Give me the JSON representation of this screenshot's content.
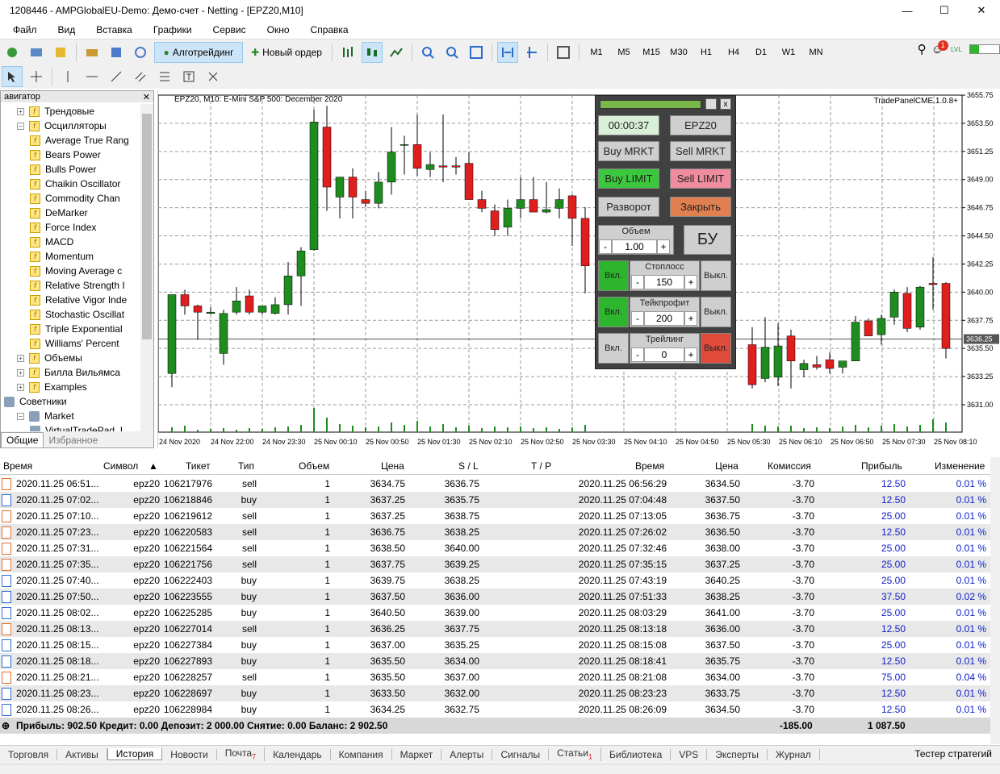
{
  "window": {
    "title": "1208446 - AMPGlobalEU-Demo: Демо-счет - Netting - [EPZ20,M10]"
  },
  "menu": [
    "Файл",
    "Вид",
    "Вставка",
    "Графики",
    "Сервис",
    "Окно",
    "Справка"
  ],
  "toolbar": {
    "algo": "Алготрейдинг",
    "new_order": "Новый ордер",
    "timeframes": [
      "M1",
      "M5",
      "M15",
      "M30",
      "H1",
      "H4",
      "D1",
      "W1",
      "MN"
    ],
    "notif_count": "1",
    "lvl": "LVL"
  },
  "navigator": {
    "title": "авигатор",
    "items": [
      {
        "label": "Трендовые",
        "type": "folder",
        "indent": 1
      },
      {
        "label": "Осцилляторы",
        "type": "folder",
        "indent": 1
      },
      {
        "label": "Average True Rang",
        "type": "f",
        "indent": 2
      },
      {
        "label": "Bears Power",
        "type": "f",
        "indent": 2
      },
      {
        "label": "Bulls Power",
        "type": "f",
        "indent": 2
      },
      {
        "label": "Chaikin Oscillator",
        "type": "f",
        "indent": 2
      },
      {
        "label": "Commodity Chan",
        "type": "f",
        "indent": 2
      },
      {
        "label": "DeMarker",
        "type": "f",
        "indent": 2
      },
      {
        "label": "Force Index",
        "type": "f",
        "indent": 2
      },
      {
        "label": "MACD",
        "type": "f",
        "indent": 2
      },
      {
        "label": "Momentum",
        "type": "f",
        "indent": 2
      },
      {
        "label": "Moving Average c",
        "type": "f",
        "indent": 2
      },
      {
        "label": "Relative Strength I",
        "type": "f",
        "indent": 2
      },
      {
        "label": "Relative Vigor Inde",
        "type": "f",
        "indent": 2
      },
      {
        "label": "Stochastic Oscillat",
        "type": "f",
        "indent": 2
      },
      {
        "label": "Triple Exponential",
        "type": "f",
        "indent": 2
      },
      {
        "label": "Williams' Percent",
        "type": "f",
        "indent": 2
      },
      {
        "label": "Объемы",
        "type": "folder",
        "indent": 1
      },
      {
        "label": "Билла Вильямса",
        "type": "folder",
        "indent": 1
      },
      {
        "label": "Examples",
        "type": "folder",
        "indent": 1
      },
      {
        "label": "Советники",
        "type": "robot",
        "indent": 0
      },
      {
        "label": "Market",
        "type": "market",
        "indent": 1
      },
      {
        "label": "VirtualTradePad_I",
        "type": "robot",
        "indent": 2
      }
    ],
    "tabs": [
      "Общие",
      "Избранное"
    ]
  },
  "chart": {
    "label": "EPZ20, M10:  E-Mini S&P 500: December 2020",
    "brand": "TradePanelCME.1.0.8+",
    "current_price": "3636.25",
    "price_ticks": [
      "3655.75",
      "3653.50",
      "3651.25",
      "3649.00",
      "3646.75",
      "3644.50",
      "3642.25",
      "3640.00",
      "3637.75",
      "3635.50",
      "3633.25",
      "3631.00"
    ],
    "time_ticks": [
      "24 Nov 2020",
      "24 Nov 22:00",
      "24 Nov 23:30",
      "25 Nov 00:10",
      "25 Nov 00:50",
      "25 Nov 01:30",
      "25 Nov 02:10",
      "25 Nov 02:50",
      "25 Nov 03:30",
      "25 Nov 04:10",
      "25 Nov 04:50",
      "25 Nov 05:30",
      "25 Nov 06:10",
      "25 Nov 06:50",
      "25 Nov 07:30",
      "25 Nov 08:10"
    ]
  },
  "panel": {
    "symbol": "EPZ20",
    "timer": "00:00:37",
    "buy_mrkt": "Buy MRKT",
    "sell_mrkt": "Sell MRKT",
    "buy_limit": "Buy LIMIT",
    "sell_limit": "Sell LIMIT",
    "reverse": "Разворот",
    "close": "Закрыть",
    "volume_label": "Объем",
    "volume": "1.00",
    "minus": "-",
    "plus": "+",
    "bu": "БУ",
    "sl_label": "Стоплосс",
    "sl": "150",
    "tp_label": "Тейкпрофит",
    "tp": "200",
    "trail_label": "Трейлинг",
    "trail": "0",
    "on": "Вкл.",
    "off": "Выкл.",
    "close_x": "x"
  },
  "history": {
    "headers": [
      "Время",
      "Символ",
      "Тикет",
      "Тип",
      "Объем",
      "Цена",
      "S / L",
      "T / P",
      "Время",
      "Цена",
      "Комиссия",
      "Прибыль",
      "Изменение"
    ],
    "rows": [
      [
        "2020.11.25 06:51...",
        "epz20",
        "106217976",
        "sell",
        "1",
        "3634.75",
        "3636.75",
        "",
        "2020.11.25 06:56:29",
        "3634.50",
        "-3.70",
        "12.50",
        "0.01 %"
      ],
      [
        "2020.11.25 07:02...",
        "epz20",
        "106218846",
        "buy",
        "1",
        "3637.25",
        "3635.75",
        "",
        "2020.11.25 07:04:48",
        "3637.50",
        "-3.70",
        "12.50",
        "0.01 %"
      ],
      [
        "2020.11.25 07:10...",
        "epz20",
        "106219612",
        "sell",
        "1",
        "3637.25",
        "3638.75",
        "",
        "2020.11.25 07:13:05",
        "3636.75",
        "-3.70",
        "25.00",
        "0.01 %"
      ],
      [
        "2020.11.25 07:23...",
        "epz20",
        "106220583",
        "sell",
        "1",
        "3636.75",
        "3638.25",
        "",
        "2020.11.25 07:26:02",
        "3636.50",
        "-3.70",
        "12.50",
        "0.01 %"
      ],
      [
        "2020.11.25 07:31...",
        "epz20",
        "106221564",
        "sell",
        "1",
        "3638.50",
        "3640.00",
        "",
        "2020.11.25 07:32:46",
        "3638.00",
        "-3.70",
        "25.00",
        "0.01 %"
      ],
      [
        "2020.11.25 07:35...",
        "epz20",
        "106221756",
        "sell",
        "1",
        "3637.75",
        "3639.25",
        "",
        "2020.11.25 07:35:15",
        "3637.25",
        "-3.70",
        "25.00",
        "0.01 %"
      ],
      [
        "2020.11.25 07:40...",
        "epz20",
        "106222403",
        "buy",
        "1",
        "3639.75",
        "3638.25",
        "",
        "2020.11.25 07:43:19",
        "3640.25",
        "-3.70",
        "25.00",
        "0.01 %"
      ],
      [
        "2020.11.25 07:50...",
        "epz20",
        "106223555",
        "buy",
        "1",
        "3637.50",
        "3636.00",
        "",
        "2020.11.25 07:51:33",
        "3638.25",
        "-3.70",
        "37.50",
        "0.02 %"
      ],
      [
        "2020.11.25 08:02...",
        "epz20",
        "106225285",
        "buy",
        "1",
        "3640.50",
        "3639.00",
        "",
        "2020.11.25 08:03:29",
        "3641.00",
        "-3.70",
        "25.00",
        "0.01 %"
      ],
      [
        "2020.11.25 08:13...",
        "epz20",
        "106227014",
        "sell",
        "1",
        "3636.25",
        "3637.75",
        "",
        "2020.11.25 08:13:18",
        "3636.00",
        "-3.70",
        "12.50",
        "0.01 %"
      ],
      [
        "2020.11.25 08:15...",
        "epz20",
        "106227384",
        "buy",
        "1",
        "3637.00",
        "3635.25",
        "",
        "2020.11.25 08:15:08",
        "3637.50",
        "-3.70",
        "25.00",
        "0.01 %"
      ],
      [
        "2020.11.25 08:18...",
        "epz20",
        "106227893",
        "buy",
        "1",
        "3635.50",
        "3634.00",
        "",
        "2020.11.25 08:18:41",
        "3635.75",
        "-3.70",
        "12.50",
        "0.01 %"
      ],
      [
        "2020.11.25 08:21...",
        "epz20",
        "106228257",
        "sell",
        "1",
        "3635.50",
        "3637.00",
        "",
        "2020.11.25 08:21:08",
        "3634.00",
        "-3.70",
        "75.00",
        "0.04 %"
      ],
      [
        "2020.11.25 08:23...",
        "epz20",
        "106228697",
        "buy",
        "1",
        "3633.50",
        "3632.00",
        "",
        "2020.11.25 08:23:23",
        "3633.75",
        "-3.70",
        "12.50",
        "0.01 %"
      ],
      [
        "2020.11.25 08:26...",
        "epz20",
        "106228984",
        "buy",
        "1",
        "3634.25",
        "3632.75",
        "",
        "2020.11.25 08:26:09",
        "3634.50",
        "-3.70",
        "12.50",
        "0.01 %"
      ]
    ],
    "totals": {
      "summary": "Прибыль: 902.50  Кредит: 0.00  Депозит: 2 000.00  Снятие: 0.00  Баланс: 2 902.50",
      "commission": "-185.00",
      "profit": "1 087.50"
    }
  },
  "bottom_tabs": [
    {
      "label": "Торговля"
    },
    {
      "label": "Активы"
    },
    {
      "label": "История",
      "active": true
    },
    {
      "label": "Новости"
    },
    {
      "label": "Почта",
      "badge": "7"
    },
    {
      "label": "Календарь"
    },
    {
      "label": "Компания"
    },
    {
      "label": "Маркет"
    },
    {
      "label": "Алерты"
    },
    {
      "label": "Сигналы"
    },
    {
      "label": "Статьи",
      "badge": "1"
    },
    {
      "label": "Библиотека"
    },
    {
      "label": "VPS"
    },
    {
      "label": "Эксперты"
    },
    {
      "label": "Журнал"
    }
  ],
  "strategy_tester": "Тестер стратегий",
  "colors": {
    "bull": "#1e8c1e",
    "bear": "#e01e1e",
    "panel_bg": "#414141",
    "buy_limit": "#3cc83c",
    "sell_limit": "#f08ca0",
    "close": "#e08050",
    "on": "#2db52d",
    "off": "#e04a3a"
  }
}
